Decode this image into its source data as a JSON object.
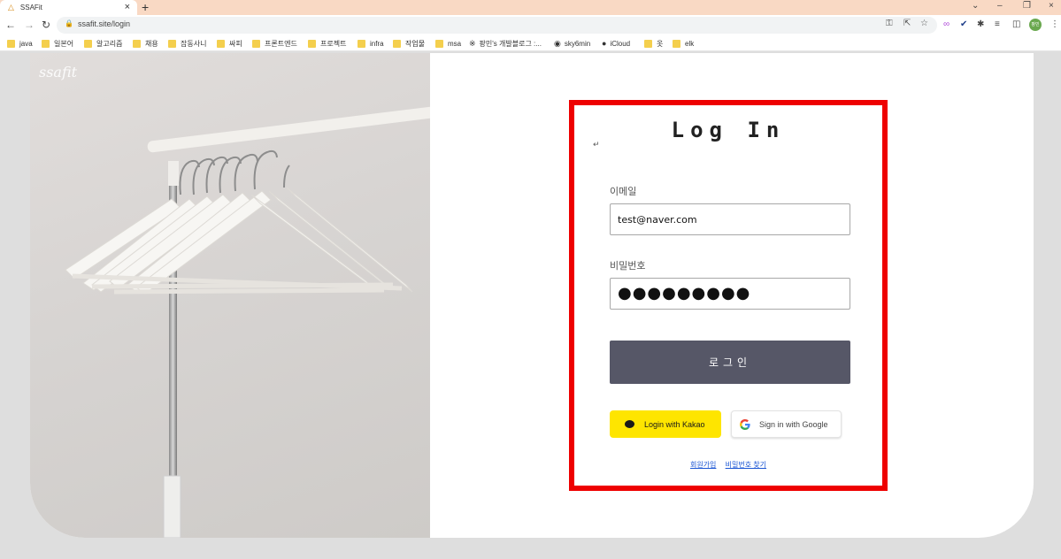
{
  "browser": {
    "tab_title": "SSAFit",
    "url": "ssafit.site/login",
    "bookmarks": [
      {
        "label": "java",
        "type": "folder"
      },
      {
        "label": "일본어",
        "type": "folder"
      },
      {
        "label": "알고리즘",
        "type": "folder"
      },
      {
        "label": "채용",
        "type": "folder"
      },
      {
        "label": "잡동사니",
        "type": "folder"
      },
      {
        "label": "싸피",
        "type": "folder"
      },
      {
        "label": "프론트엔드",
        "type": "folder"
      },
      {
        "label": "프로젝트",
        "type": "folder"
      },
      {
        "label": "infra",
        "type": "folder"
      },
      {
        "label": "작업물",
        "type": "folder"
      },
      {
        "label": "msa",
        "type": "folder"
      },
      {
        "label": "팡민's 개발블로그 :...",
        "type": "link"
      },
      {
        "label": "sky6min",
        "type": "link"
      },
      {
        "label": "iCloud",
        "type": "link"
      },
      {
        "label": "옷",
        "type": "folder"
      },
      {
        "label": "elk",
        "type": "folder"
      }
    ],
    "avatar_text": "팡민"
  },
  "page": {
    "logo": "ssafit"
  },
  "login": {
    "title": "Log In",
    "email_label": "이메일",
    "email_value": "test@naver.com",
    "password_label": "비밀번호",
    "password_value": "●●●●●●●●●",
    "submit_label": "로그인",
    "kakao_label": "Login with Kakao",
    "google_label": "Sign in with Google",
    "signup_link": "회원가입",
    "find_password_link": "비밀번호 찾기"
  },
  "colors": {
    "highlight_border": "#ee0000",
    "login_button": "#565767",
    "kakao": "#fee500",
    "link": "#1a55d4"
  }
}
